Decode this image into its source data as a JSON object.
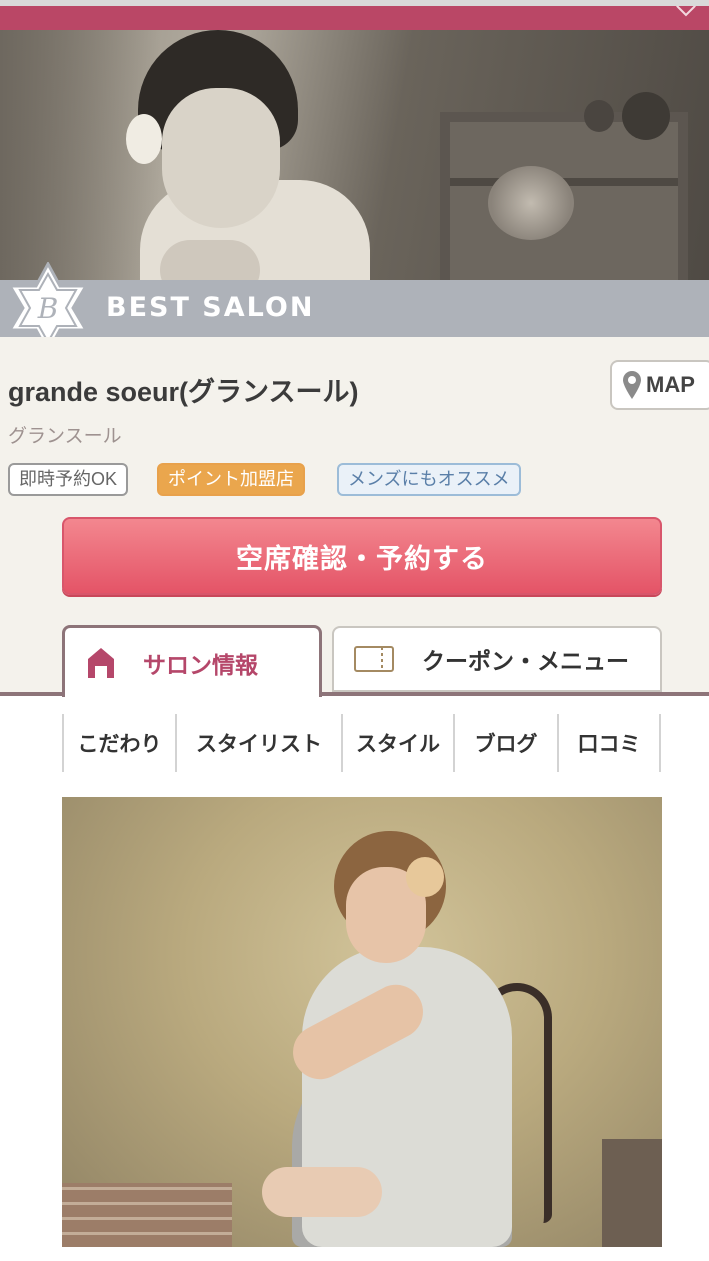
{
  "header": {
    "favorite_icon": "heart-outline-icon",
    "accent_color": "#ba4766"
  },
  "hero": {
    "image": "salon-hero-photo"
  },
  "best_salon": {
    "label": "BEST SALON",
    "badge_letter": "B"
  },
  "salon": {
    "name": "grande soeur(グランスール)",
    "kana": "グランスール",
    "map_label": "MAP",
    "tags": [
      "即時予約OK",
      "ポイント加盟店",
      "メンズにもオススメ"
    ]
  },
  "reserve_button": {
    "label": "空席確認・予約する",
    "color": "#e45467"
  },
  "tabs": [
    {
      "label": "サロン情報",
      "icon": "house-icon",
      "active": true
    },
    {
      "label": "クーポン・メニュー",
      "icon": "ticket-icon",
      "active": false
    }
  ],
  "subnav": [
    "こだわり",
    "スタイリスト",
    "スタイル",
    "ブログ",
    "口コミ"
  ],
  "main_photo": "salon-style-photo"
}
